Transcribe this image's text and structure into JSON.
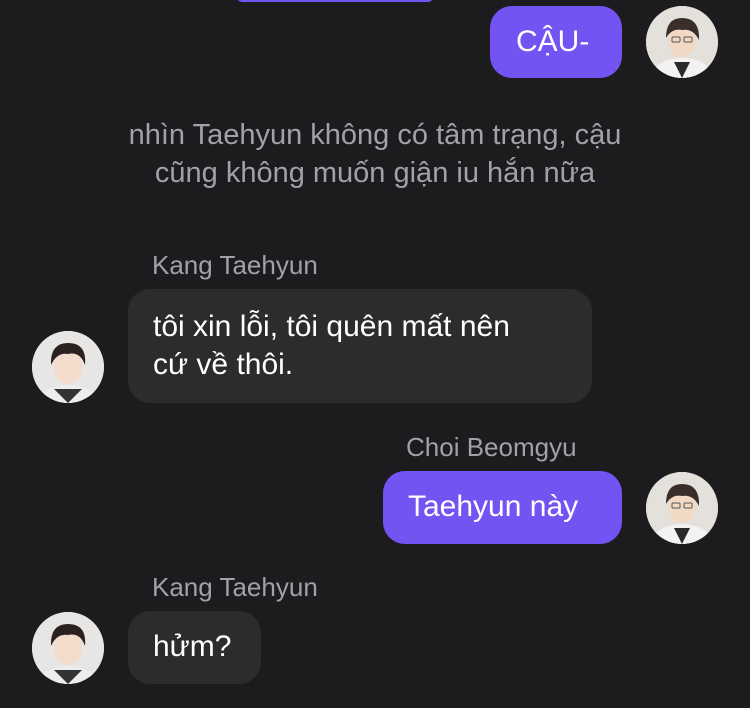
{
  "theme": {
    "background": "#1c1c1e",
    "outgoing_bubble": "#7354f2",
    "incoming_bubble": "#2c2c2e",
    "secondary_text": "#a1a1a6"
  },
  "messages": [
    {
      "direction": "outgoing",
      "sender": "",
      "text": "CẬU-",
      "avatar": "avatar-choi-beomgyu"
    },
    {
      "type": "narration",
      "lines": [
        "nhìn Taehyun không có tâm trạng, cậu",
        "cũng không muốn giận iu hắn nữa"
      ]
    },
    {
      "direction": "incoming",
      "sender": "Kang Taehyun",
      "lines": [
        "tôi xin lỗi, tôi quên mất nên",
        "cứ về thôi."
      ],
      "avatar": "avatar-kang-taehyun"
    },
    {
      "direction": "outgoing",
      "sender": "Choi Beomgyu",
      "text": "Taehyun này",
      "avatar": "avatar-choi-beomgyu"
    },
    {
      "direction": "incoming",
      "sender": "Kang Taehyun",
      "text": "hửm?",
      "avatar": "avatar-kang-taehyun"
    }
  ]
}
